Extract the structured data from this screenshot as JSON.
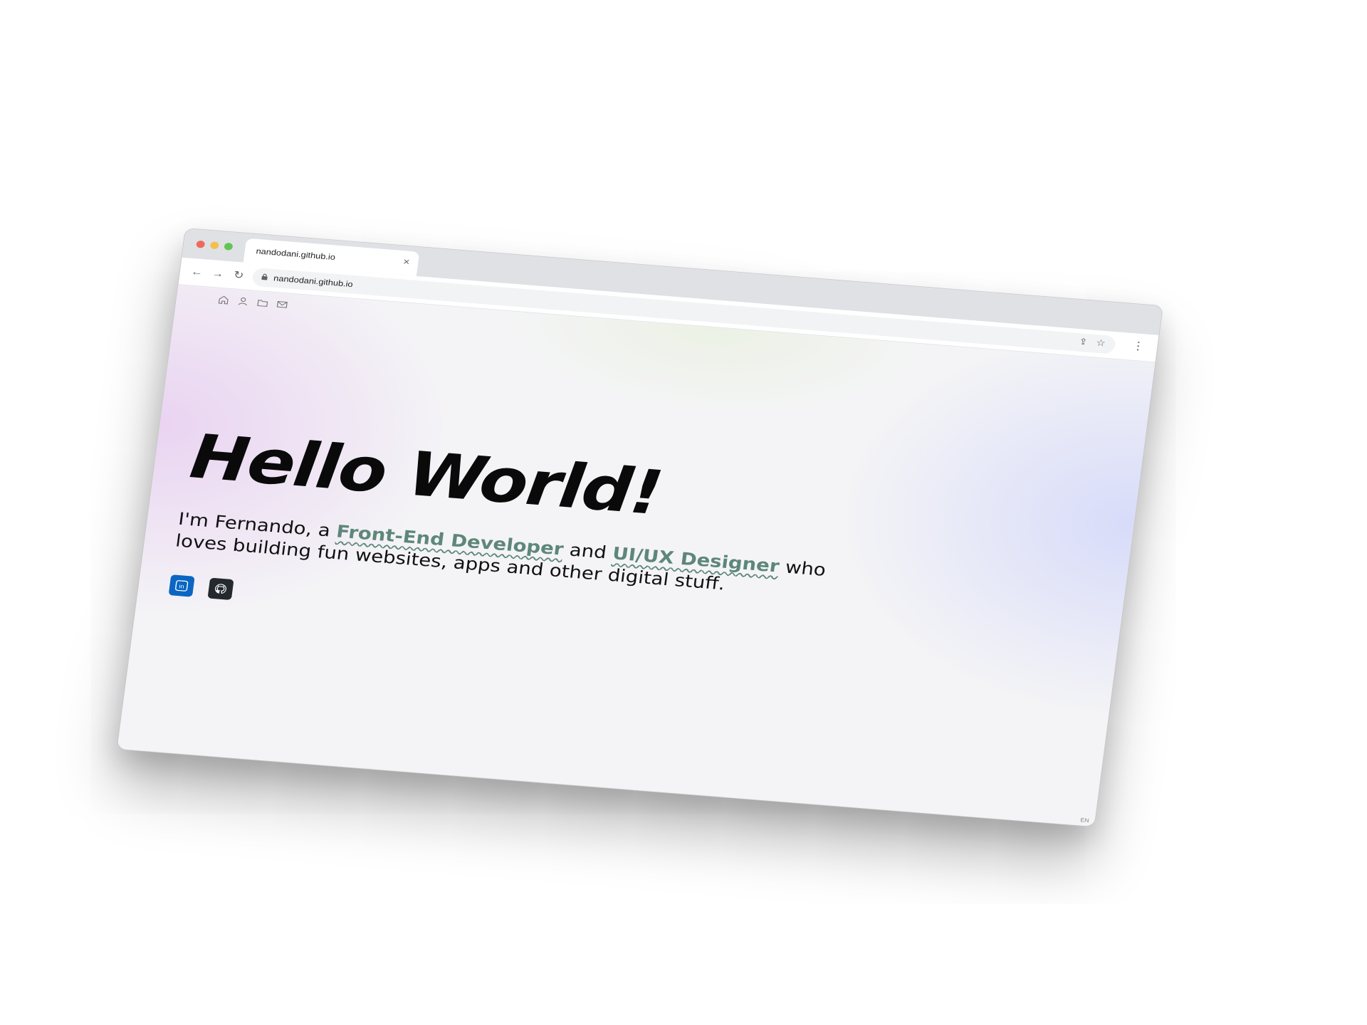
{
  "browser": {
    "tab_title": "nandodani.github.io",
    "tab_close": "×",
    "url": "nandodani.github.io",
    "nav": {
      "back": "←",
      "forward": "→",
      "reload": "↻"
    },
    "lock_glyph": "🔒",
    "share_glyph": "⇪",
    "star_glyph": "☆",
    "menu_glyph": "⋮"
  },
  "site_nav": {
    "icons": [
      "home-icon",
      "user-icon",
      "folder-icon",
      "mail-icon"
    ]
  },
  "hero": {
    "title": "Hello World!",
    "intro": "I'm Fernando, a ",
    "role1": "Front-End Developer",
    "connector": " and ",
    "role2": "UI/UX Designer",
    "outro": " who loves building fun websites, apps and other digital stuff."
  },
  "social": {
    "linkedin_label": "in",
    "icons": [
      "linkedin-icon",
      "github-icon"
    ]
  },
  "footer": {
    "lang": "EN"
  },
  "colors": {
    "accent": "#5e8778",
    "linkedin": "#0a66c2",
    "github": "#24292e"
  }
}
